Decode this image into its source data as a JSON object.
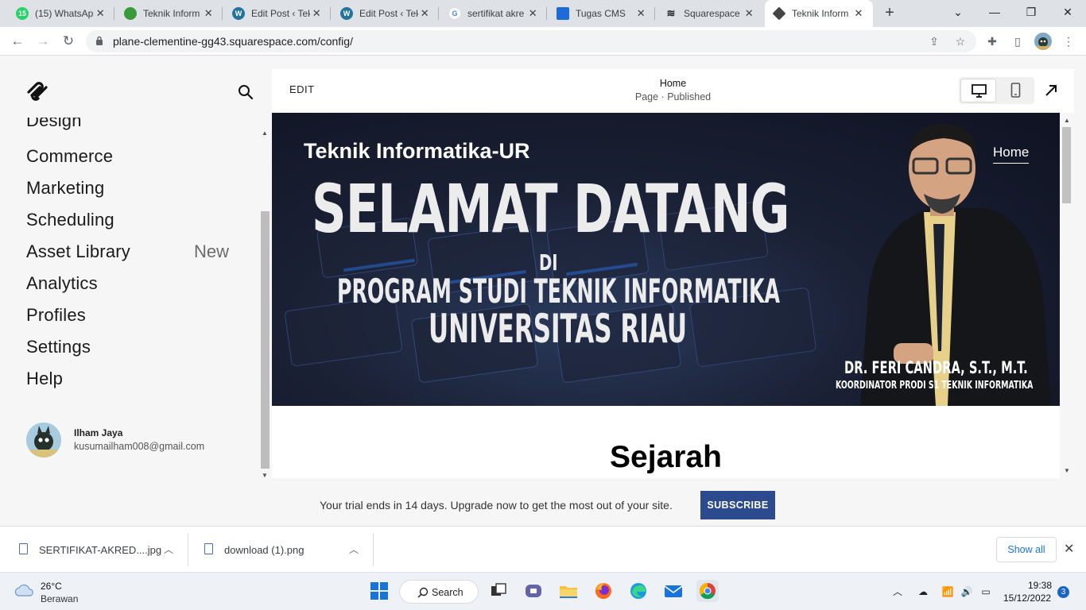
{
  "browser": {
    "tabs": [
      {
        "title": "(15) WhatsAp",
        "favicon": "whatsapp-icon",
        "color": "#25d366"
      },
      {
        "title": "Teknik Inform",
        "favicon": "ur-logo-icon",
        "color": "#3a9a3a"
      },
      {
        "title": "Edit Post ‹ Tek",
        "favicon": "wordpress-icon",
        "color": "#21759b"
      },
      {
        "title": "Edit Post ‹ Tek",
        "favicon": "wordpress-icon",
        "color": "#21759b"
      },
      {
        "title": "sertifikat akre",
        "favicon": "google-icon",
        "color": "#4285f4"
      },
      {
        "title": "Tugas CMS",
        "favicon": "classroom-icon",
        "color": "#1e6ad6"
      },
      {
        "title": "Squarespace",
        "favicon": "squarespace-icon",
        "color": "#222222"
      },
      {
        "title": "Teknik Inform",
        "favicon": "cube-icon",
        "color": "#444444",
        "active": true
      }
    ],
    "url": "plane-clementine-gg43.squarespace.com/config/"
  },
  "sidebar": {
    "partial_item": "Design",
    "items": [
      "Commerce",
      "Marketing",
      "Scheduling",
      "Asset Library",
      "Analytics",
      "Profiles",
      "Settings",
      "Help"
    ],
    "asset_badge": "New",
    "user": {
      "name": "Ilham Jaya",
      "email": "kusumailham008@gmail.com"
    }
  },
  "editor": {
    "edit_label": "EDIT",
    "page_title": "Home",
    "page_status": "Page · Published"
  },
  "site": {
    "title": "Teknik Informatika-UR",
    "nav_home": "Home",
    "banner": {
      "line1": "SELAMAT DATANG",
      "line_di": "DI",
      "line2": "PROGRAM STUDI TEKNIK INFORMATIKA",
      "line3": "UNIVERSITAS RIAU",
      "person_name": "DR. FERI CANDRA, S.T., M.T.",
      "person_role": "KOORDINATOR PRODI S1 TEKNIK INFORMATIKA"
    },
    "section_heading": "Sejarah"
  },
  "trial": {
    "text": "Your trial ends in 14 days. Upgrade now to get the most out of your site.",
    "button": "SUBSCRIBE"
  },
  "downloads": {
    "items": [
      "SERTIFIKAT-AKRED....jpg",
      "download (1).png"
    ],
    "show_all": "Show all"
  },
  "taskbar": {
    "temperature": "26°C",
    "weather": "Berawan",
    "search": "Search",
    "time": "19:38",
    "date": "15/12/2022",
    "notifications": "3"
  },
  "colors": {
    "subscribe": "#2c4b8e",
    "accent_blue": "#1a73e8"
  }
}
